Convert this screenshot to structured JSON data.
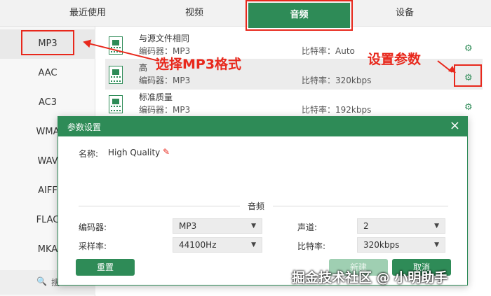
{
  "tabs": {
    "recent": "最近使用",
    "video": "视频",
    "audio": "音频",
    "device": "设备"
  },
  "formats": [
    "MP3",
    "AAC",
    "AC3",
    "WMA",
    "WAV",
    "AIFF",
    "FLAC",
    "MKA"
  ],
  "search": {
    "label": "搜"
  },
  "presets": [
    {
      "name": "与源文件相同",
      "encoder": "编码器：MP3",
      "bitrate": "比特率：Auto"
    },
    {
      "name": "高",
      "encoder": "编码器：MP3",
      "bitrate": "比特率：320kbps"
    },
    {
      "name": "标准质量",
      "encoder": "编码器：MP3",
      "bitrate": "比特率：192kbps"
    }
  ],
  "annotations": {
    "select_format": "选择MP3格式",
    "set_params": "设置参数"
  },
  "dialog": {
    "title": "参数设置",
    "close": "×",
    "name_label": "名称:",
    "name_value": "High Quality",
    "section": "音频",
    "encoder_label": "编码器:",
    "encoder_value": "MP3",
    "samplerate_label": "采样率:",
    "samplerate_value": "44100Hz",
    "channel_label": "声道:",
    "channel_value": "2",
    "bitrate_label": "比特率:",
    "bitrate_value": "320kbps",
    "reset": "重置",
    "new": "新建",
    "cancel": "取消"
  },
  "watermark": "掘金技术社区 @ 小明助手",
  "colors": {
    "accent": "#2e8b57",
    "annotation": "#e8281c"
  }
}
